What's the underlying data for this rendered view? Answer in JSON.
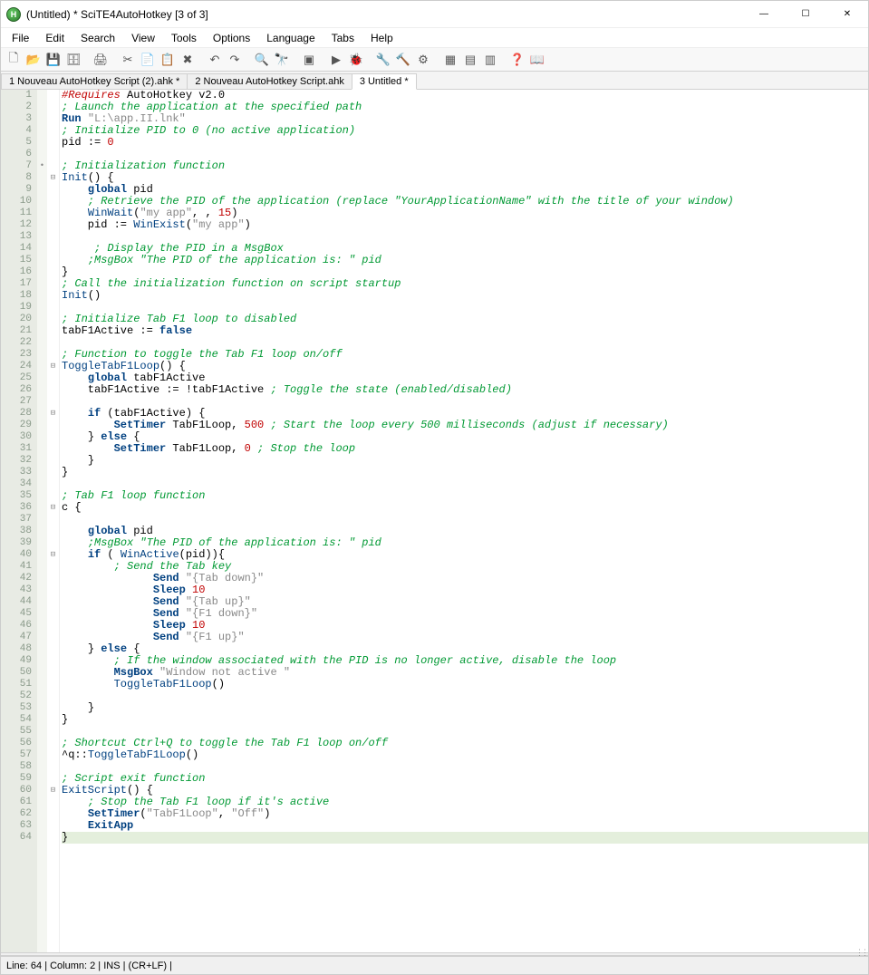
{
  "window": {
    "title": "(Untitled) * SciTE4AutoHotkey [3 of 3]",
    "icon_label": "H"
  },
  "menu": {
    "items": [
      "File",
      "Edit",
      "Search",
      "View",
      "Tools",
      "Options",
      "Language",
      "Tabs",
      "Help"
    ]
  },
  "toolbar_icons": [
    "new-file-icon",
    "open-file-icon",
    "save-icon",
    "save-all-icon",
    "sep",
    "print-icon",
    "sep",
    "cut-icon",
    "copy-icon",
    "paste-icon",
    "delete-icon",
    "sep",
    "undo-icon",
    "redo-icon",
    "sep",
    "find-icon",
    "replace-icon",
    "sep",
    "stop-macro-icon",
    "sep",
    "run-icon",
    "debug-icon",
    "sep",
    "tool1-icon",
    "tool2-icon",
    "tool3-icon",
    "sep",
    "panel1-icon",
    "panel2-icon",
    "panel3-icon",
    "sep",
    "help1-icon",
    "help2-icon"
  ],
  "tabs": [
    {
      "label": "1 Nouveau AutoHotkey Script (2).ahk *",
      "active": false
    },
    {
      "label": "2 Nouveau AutoHotkey Script.ahk",
      "active": false
    },
    {
      "label": "3 Untitled *",
      "active": true
    }
  ],
  "code": {
    "line_count": 64,
    "highlight_line": 64,
    "fold_markers": {
      "8": "⊟",
      "24": "⊟",
      "28": "⊟",
      "36": "⊟",
      "40": "⊟",
      "60": "⊟"
    },
    "change_markers": [
      7
    ],
    "lines": [
      [
        [
          "c-dir",
          "#Requires"
        ],
        [
          "c-id",
          " AutoHotkey v2.0"
        ]
      ],
      [
        [
          "c-cmt",
          "; Launch the application at the specified path"
        ]
      ],
      [
        [
          "c-kw",
          "Run"
        ],
        [
          "c-id",
          " "
        ],
        [
          "c-str",
          "\"L:\\app.II.lnk\""
        ]
      ],
      [
        [
          "c-cmt",
          "; Initialize PID to 0 (no active application)"
        ]
      ],
      [
        [
          "c-id",
          "pid "
        ],
        [
          "c-op",
          ":="
        ],
        [
          "c-id",
          " "
        ],
        [
          "c-num",
          "0"
        ]
      ],
      [],
      [
        [
          "c-cmt",
          "; Initialization function"
        ]
      ],
      [
        [
          "c-fn",
          "Init"
        ],
        [
          "c-op",
          "() {"
        ]
      ],
      [
        [
          "c-id",
          "    "
        ],
        [
          "c-kw",
          "global"
        ],
        [
          "c-id",
          " pid"
        ]
      ],
      [
        [
          "c-id",
          "    "
        ],
        [
          "c-cmt",
          "; Retrieve the PID of the application (replace \"YourApplicationName\" with the title of your window)"
        ]
      ],
      [
        [
          "c-id",
          "    "
        ],
        [
          "c-fn",
          "WinWait"
        ],
        [
          "c-op",
          "("
        ],
        [
          "c-str",
          "\"my app\""
        ],
        [
          "c-op",
          ", , "
        ],
        [
          "c-num",
          "15"
        ],
        [
          "c-op",
          ")"
        ]
      ],
      [
        [
          "c-id",
          "    pid "
        ],
        [
          "c-op",
          ":="
        ],
        [
          "c-id",
          " "
        ],
        [
          "c-fn",
          "WinExist"
        ],
        [
          "c-op",
          "("
        ],
        [
          "c-str",
          "\"my app\""
        ],
        [
          "c-op",
          ")"
        ]
      ],
      [],
      [
        [
          "c-id",
          "     "
        ],
        [
          "c-cmt",
          "; Display the PID in a MsgBox"
        ]
      ],
      [
        [
          "c-id",
          "    "
        ],
        [
          "c-cmt",
          ";MsgBox \"The PID of the application is: \" pid"
        ]
      ],
      [
        [
          "c-op",
          "}"
        ]
      ],
      [
        [
          "c-cmt",
          "; Call the initialization function on script startup"
        ]
      ],
      [
        [
          "c-fn",
          "Init"
        ],
        [
          "c-op",
          "()"
        ]
      ],
      [],
      [
        [
          "c-cmt",
          "; Initialize Tab F1 loop to disabled"
        ]
      ],
      [
        [
          "c-id",
          "tabF1Active "
        ],
        [
          "c-op",
          ":="
        ],
        [
          "c-id",
          " "
        ],
        [
          "c-kw",
          "false"
        ]
      ],
      [],
      [
        [
          "c-cmt",
          "; Function to toggle the Tab F1 loop on/off"
        ]
      ],
      [
        [
          "c-fn",
          "ToggleTabF1Loop"
        ],
        [
          "c-op",
          "() {"
        ]
      ],
      [
        [
          "c-id",
          "    "
        ],
        [
          "c-kw",
          "global"
        ],
        [
          "c-id",
          " tabF1Active"
        ]
      ],
      [
        [
          "c-id",
          "    tabF1Active "
        ],
        [
          "c-op",
          ":= !"
        ],
        [
          "c-id",
          "tabF1Active "
        ],
        [
          "c-cmt",
          "; Toggle the state (enabled/disabled)"
        ]
      ],
      [],
      [
        [
          "c-id",
          "    "
        ],
        [
          "c-kw",
          "if"
        ],
        [
          "c-id",
          " "
        ],
        [
          "c-op",
          "("
        ],
        [
          "c-id",
          "tabF1Active"
        ],
        [
          "c-op",
          ") {"
        ]
      ],
      [
        [
          "c-id",
          "        "
        ],
        [
          "c-kw",
          "SetTimer"
        ],
        [
          "c-id",
          " TabF1Loop"
        ],
        [
          "c-op",
          ", "
        ],
        [
          "c-num",
          "500"
        ],
        [
          "c-id",
          " "
        ],
        [
          "c-cmt",
          "; Start the loop every 500 milliseconds (adjust if necessary)"
        ]
      ],
      [
        [
          "c-id",
          "    "
        ],
        [
          "c-op",
          "}"
        ],
        [
          "c-id",
          " "
        ],
        [
          "c-kw",
          "else"
        ],
        [
          "c-id",
          " "
        ],
        [
          "c-op",
          "{"
        ]
      ],
      [
        [
          "c-id",
          "        "
        ],
        [
          "c-kw",
          "SetTimer"
        ],
        [
          "c-id",
          " TabF1Loop"
        ],
        [
          "c-op",
          ", "
        ],
        [
          "c-num",
          "0"
        ],
        [
          "c-id",
          " "
        ],
        [
          "c-cmt",
          "; Stop the loop"
        ]
      ],
      [
        [
          "c-id",
          "    "
        ],
        [
          "c-op",
          "}"
        ]
      ],
      [
        [
          "c-op",
          "}"
        ]
      ],
      [],
      [
        [
          "c-cmt",
          "; Tab F1 loop function"
        ]
      ],
      [
        [
          "c-id",
          "c "
        ],
        [
          "c-op",
          "{"
        ]
      ],
      [],
      [
        [
          "c-id",
          "    "
        ],
        [
          "c-kw",
          "global"
        ],
        [
          "c-id",
          " pid"
        ]
      ],
      [
        [
          "c-id",
          "    "
        ],
        [
          "c-cmt",
          ";MsgBox \"The PID of the application is: \" pid"
        ]
      ],
      [
        [
          "c-id",
          "    "
        ],
        [
          "c-kw",
          "if"
        ],
        [
          "c-id",
          " "
        ],
        [
          "c-op",
          "( "
        ],
        [
          "c-fn",
          "WinActive"
        ],
        [
          "c-op",
          "("
        ],
        [
          "c-id",
          "pid"
        ],
        [
          "c-op",
          ")){"
        ]
      ],
      [
        [
          "c-id",
          "        "
        ],
        [
          "c-cmt",
          "; Send the Tab key"
        ]
      ],
      [
        [
          "c-id",
          "              "
        ],
        [
          "c-kw",
          "Send"
        ],
        [
          "c-id",
          " "
        ],
        [
          "c-str",
          "\"{Tab down}\""
        ]
      ],
      [
        [
          "c-id",
          "              "
        ],
        [
          "c-kw",
          "Sleep"
        ],
        [
          "c-id",
          " "
        ],
        [
          "c-num",
          "10"
        ]
      ],
      [
        [
          "c-id",
          "              "
        ],
        [
          "c-kw",
          "Send"
        ],
        [
          "c-id",
          " "
        ],
        [
          "c-str",
          "\"{Tab up}\""
        ]
      ],
      [
        [
          "c-id",
          "              "
        ],
        [
          "c-kw",
          "Send"
        ],
        [
          "c-id",
          " "
        ],
        [
          "c-str",
          "\"{F1 down}\""
        ]
      ],
      [
        [
          "c-id",
          "              "
        ],
        [
          "c-kw",
          "Sleep"
        ],
        [
          "c-id",
          " "
        ],
        [
          "c-num",
          "10"
        ]
      ],
      [
        [
          "c-id",
          "              "
        ],
        [
          "c-kw",
          "Send"
        ],
        [
          "c-id",
          " "
        ],
        [
          "c-str",
          "\"{F1 up}\""
        ]
      ],
      [
        [
          "c-id",
          "    "
        ],
        [
          "c-op",
          "}"
        ],
        [
          "c-id",
          " "
        ],
        [
          "c-kw",
          "else"
        ],
        [
          "c-id",
          " "
        ],
        [
          "c-op",
          "{"
        ]
      ],
      [
        [
          "c-id",
          "        "
        ],
        [
          "c-cmt",
          "; If the window associated with the PID is no longer active, disable the loop"
        ]
      ],
      [
        [
          "c-id",
          "        "
        ],
        [
          "c-kw",
          "MsgBox"
        ],
        [
          "c-id",
          " "
        ],
        [
          "c-str",
          "\"Window not active \""
        ]
      ],
      [
        [
          "c-id",
          "        "
        ],
        [
          "c-fn",
          "ToggleTabF1Loop"
        ],
        [
          "c-op",
          "()"
        ]
      ],
      [],
      [
        [
          "c-id",
          "    "
        ],
        [
          "c-op",
          "}"
        ]
      ],
      [
        [
          "c-op",
          "}"
        ]
      ],
      [],
      [
        [
          "c-cmt",
          "; Shortcut Ctrl+Q to toggle the Tab F1 loop on/off"
        ]
      ],
      [
        [
          "c-op",
          "^q::"
        ],
        [
          "c-fn",
          "ToggleTabF1Loop"
        ],
        [
          "c-op",
          "()"
        ]
      ],
      [],
      [
        [
          "c-cmt",
          "; Script exit function"
        ]
      ],
      [
        [
          "c-fn",
          "ExitScript"
        ],
        [
          "c-op",
          "() {"
        ]
      ],
      [
        [
          "c-id",
          "    "
        ],
        [
          "c-cmt",
          "; Stop the Tab F1 loop if it's active"
        ]
      ],
      [
        [
          "c-id",
          "    "
        ],
        [
          "c-kw",
          "SetTimer"
        ],
        [
          "c-op",
          "("
        ],
        [
          "c-str",
          "\"TabF1Loop\""
        ],
        [
          "c-op",
          ", "
        ],
        [
          "c-str",
          "\"Off\""
        ],
        [
          "c-op",
          ")"
        ]
      ],
      [
        [
          "c-id",
          "    "
        ],
        [
          "c-kw",
          "ExitApp"
        ]
      ],
      [
        [
          "c-op",
          "}"
        ]
      ]
    ]
  },
  "status": {
    "text": "Line: 64 | Column: 2 | INS | (CR+LF) |"
  }
}
